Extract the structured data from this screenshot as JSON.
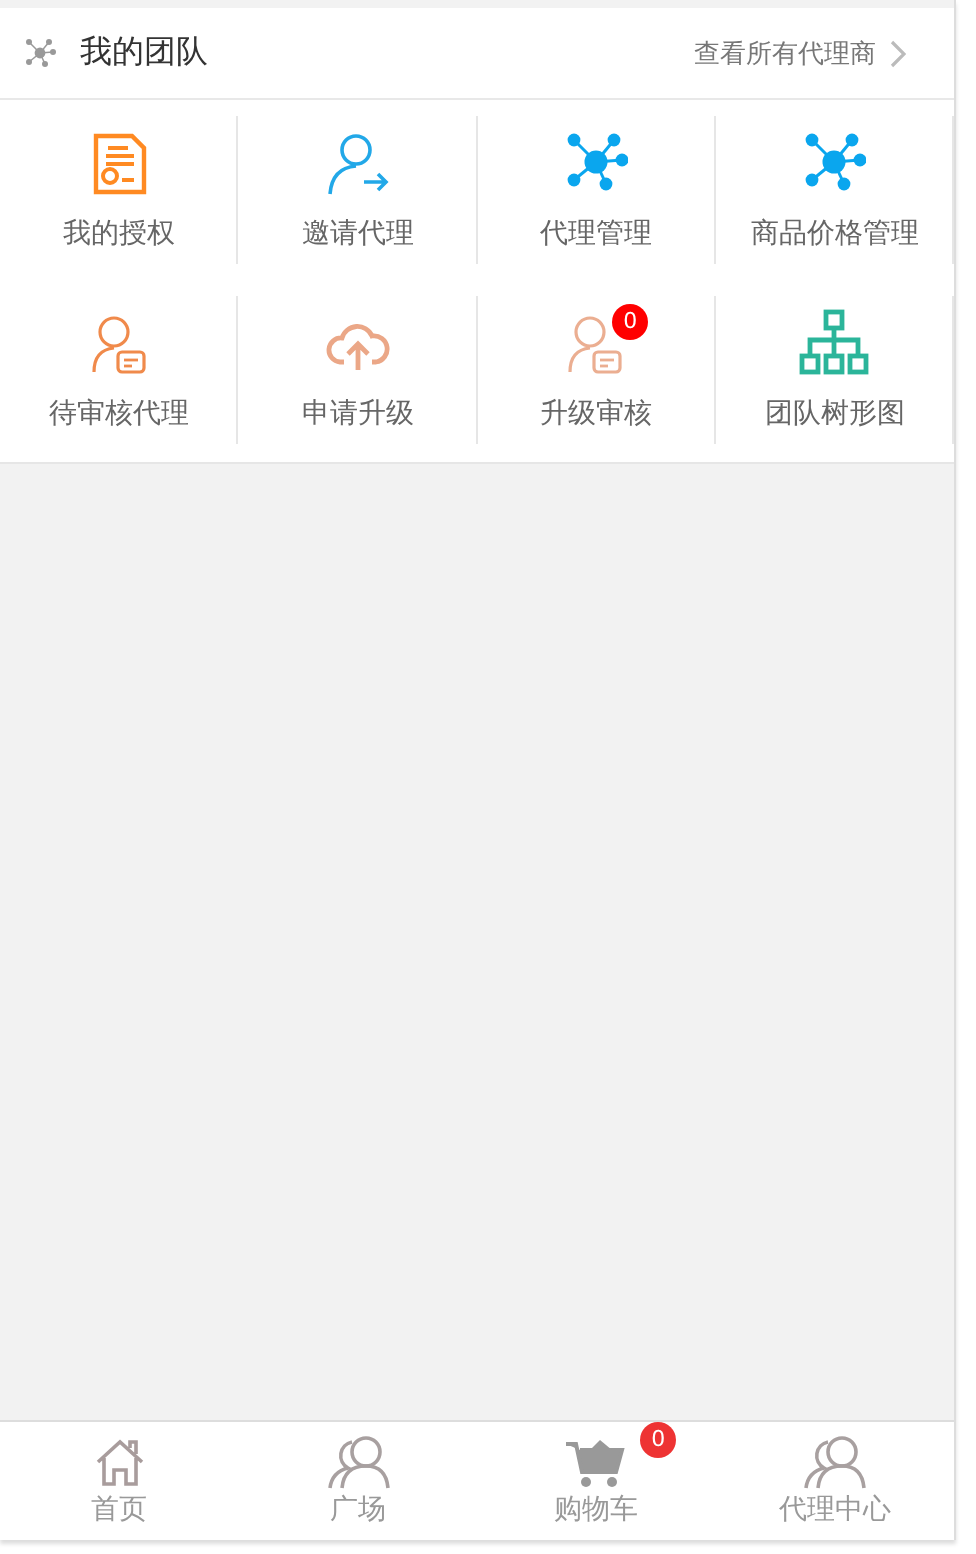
{
  "header": {
    "title": "我的团队",
    "link": "查看所有代理商"
  },
  "grid": [
    {
      "label": "我的授权"
    },
    {
      "label": "邀请代理"
    },
    {
      "label": "代理管理"
    },
    {
      "label": "商品价格管理"
    },
    {
      "label": "待审核代理"
    },
    {
      "label": "申请升级"
    },
    {
      "label": "升级审核",
      "badge": "0"
    },
    {
      "label": "团队树形图"
    }
  ],
  "tabbar": [
    {
      "label": "首页"
    },
    {
      "label": "广场"
    },
    {
      "label": "购物车",
      "badge": "0"
    },
    {
      "label": "代理中心"
    }
  ]
}
